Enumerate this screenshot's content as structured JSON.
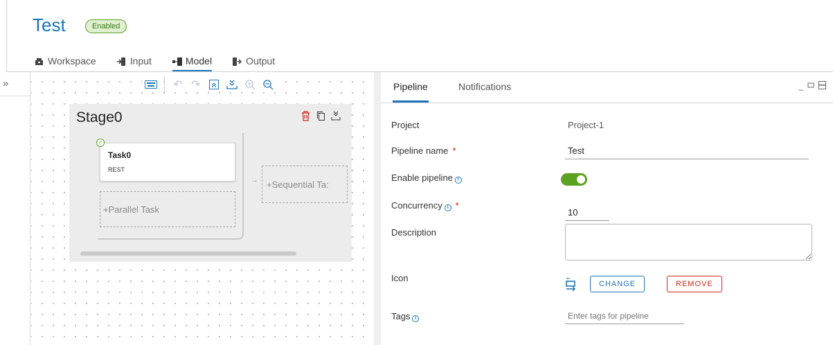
{
  "header": {
    "title": "Test",
    "status_badge": "Enabled",
    "tabs": [
      {
        "label": "Workspace",
        "icon": "workspace-icon"
      },
      {
        "label": "Input",
        "icon": "input-icon"
      },
      {
        "label": "Model",
        "icon": "model-icon",
        "active": true
      },
      {
        "label": "Output",
        "icon": "output-icon"
      }
    ]
  },
  "sidebar": {
    "collapse_glyph": "»"
  },
  "canvas": {
    "toolbar": [
      "keyboard-icon",
      "undo-icon",
      "redo-icon",
      "collapse-all-icon",
      "expand-all-icon",
      "zoom-in-icon",
      "zoom-out-icon"
    ],
    "stage": {
      "name": "Stage0",
      "task": {
        "name": "Task0",
        "type": "REST"
      },
      "add_parallel": "+Parallel Task",
      "add_sequential": "+Sequential Ta:"
    }
  },
  "panel": {
    "tabs": [
      {
        "label": "Pipeline",
        "active": true
      },
      {
        "label": "Notifications"
      }
    ],
    "fields": {
      "project_label": "Project",
      "project_value": "Project-1",
      "pipeline_name_label": "Pipeline name",
      "pipeline_name_value": "Test",
      "enable_label": "Enable pipeline",
      "enable_value": true,
      "concurrency_label": "Concurrency",
      "concurrency_value": "10",
      "description_label": "Description",
      "description_value": "",
      "icon_label": "Icon",
      "change_button": "CHANGE",
      "remove_button": "REMOVE",
      "tags_label": "Tags",
      "tags_placeholder": "Enter tags for pipeline"
    },
    "required_mark": "*"
  },
  "colors": {
    "accent": "#1a74b8",
    "success": "#5aa220",
    "danger": "#d0271a"
  }
}
